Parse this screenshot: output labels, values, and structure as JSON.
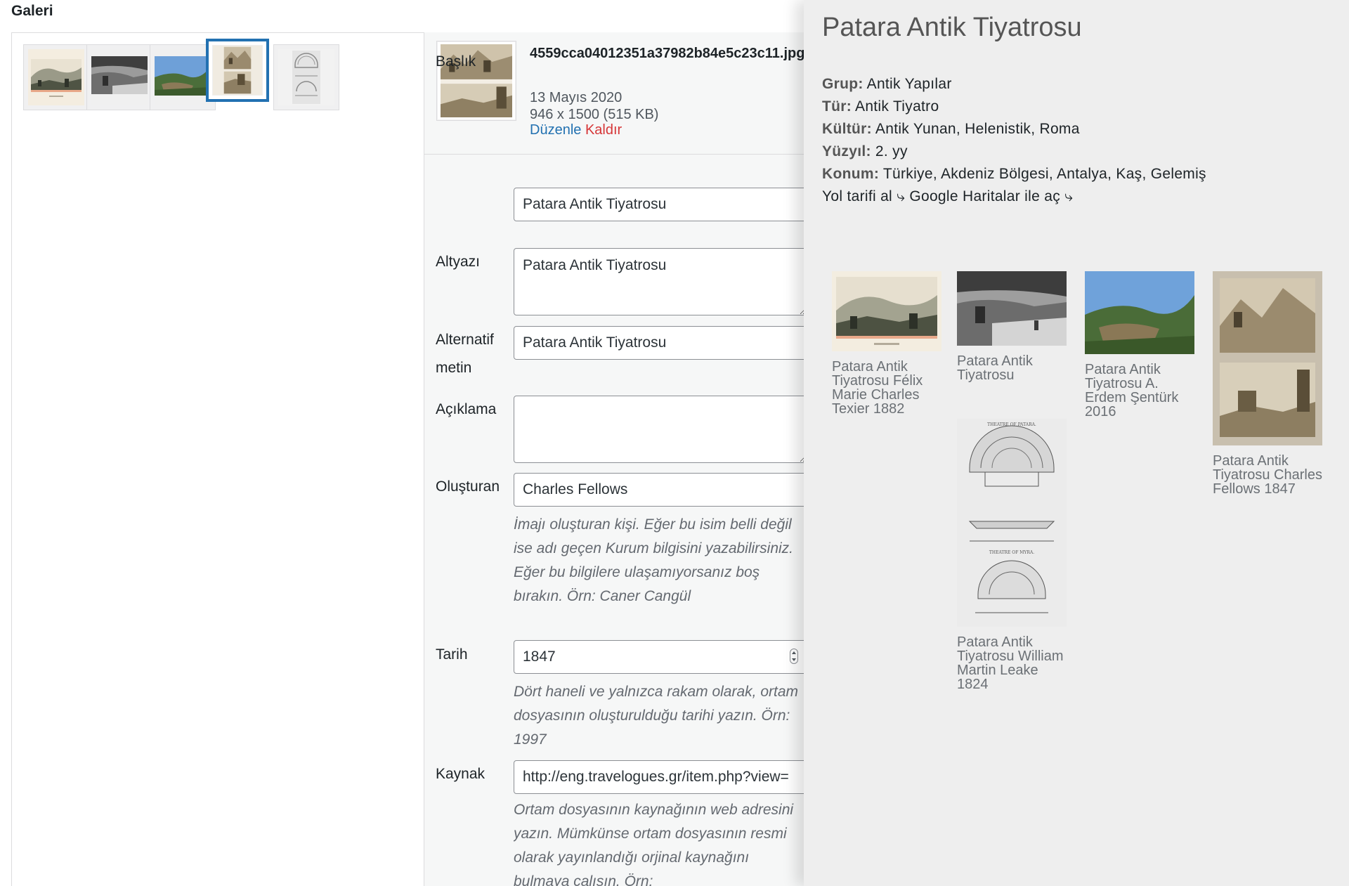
{
  "gallery": {
    "label": "Galeri",
    "thumbs": [
      {
        "icon": "engraving-landscape-thumbnail"
      },
      {
        "icon": "grayscale-photo-thumbnail"
      },
      {
        "icon": "color-photo-thumbnail"
      },
      {
        "icon": "sepia-two-panel-thumbnail",
        "selected": true
      },
      {
        "icon": "plan-drawing-thumbnail"
      }
    ]
  },
  "attachment": {
    "filename": "4559cca04012351a37982b84e5c23c11.jpg",
    "date": "13 Mayıs 2020",
    "dimensions": "946 x 1500 (515 KB)",
    "edit_label": "Düzenle",
    "delete_label": "Kaldır"
  },
  "fields": {
    "title_label": "Başlık",
    "title_value": "Patara Antik Tiyatrosu",
    "caption_label": "Altyazı",
    "caption_value": "Patara Antik Tiyatrosu",
    "alt_label_1": "Alternatif",
    "alt_label_2": "metin",
    "alt_value": "Patara Antik Tiyatrosu",
    "description_label": "Açıklama",
    "description_value": "",
    "creator_label": "Oluşturan",
    "creator_value": "Charles Fellows",
    "creator_help": "İmajı oluşturan kişi. Eğer bu isim belli değil ise adı geçen Kurum bilgisini yazabilirsiniz. Eğer bu bilgilere ulaşamıyorsanız boş bırakın. Örn: Caner Cangül",
    "date_label": "Tarih",
    "date_value": "1847",
    "date_help": "Dört haneli ve yalnızca rakam olarak, ortam dosyasının oluşturulduğu tarihi yazın. Örn: 1997",
    "source_label": "Kaynak",
    "source_value": "http://eng.travelogues.gr/item.php?view=",
    "source_help": "Ortam dosyasının kaynağının web adresini yazın. Mümkünse ortam dosyasının resmi olarak yayınlandığı orjinal kaynağını bulmaya çalışın. Örn: https://archives.saltresearch.org/handle"
  },
  "preview": {
    "title": "Patara Antik Tiyatrosu",
    "info": {
      "group_key": "Grup:",
      "group_val": "Antik Yapılar",
      "type_key": "Tür:",
      "type_val": "Antik Tiyatro",
      "culture_key": "Kültür:",
      "culture_val": "Antik Yunan, Helenistik, Roma",
      "century_key": "Yüzyıl:",
      "century_val": "2. yy",
      "location_key": "Konum:",
      "location_val": "Türkiye, Akdeniz Bölgesi, Antalya, Kaş, Gelemiş",
      "directions": "Yol tarifi al ⤷ Google Haritalar ile aç ⤷"
    },
    "items": [
      {
        "caption": "Patara Antik Tiyatrosu Félix Marie Charles Texier 1882",
        "icon": "engraving-landscape-image"
      },
      {
        "caption": "Patara Antik Tiyatrosu",
        "icon": "grayscale-photo-image"
      },
      {
        "caption": "Patara Antik Tiyatrosu A. Erdem Şentürk 2016",
        "icon": "color-photo-image"
      },
      {
        "caption": "Patara Antik Tiyatrosu Charles Fellows 1847",
        "icon": "sepia-two-panel-image"
      },
      {
        "caption": "Patara Antik Tiyatrosu William Martin Leake 1824",
        "icon": "plan-drawing-image"
      }
    ],
    "plan_texts": [
      "THEATRE OF PATARA.",
      "THEATRE OF MYRA."
    ]
  },
  "colors": {
    "accent": "#2271b1",
    "danger": "#d63638",
    "panel_bg": "#eeeeee"
  }
}
